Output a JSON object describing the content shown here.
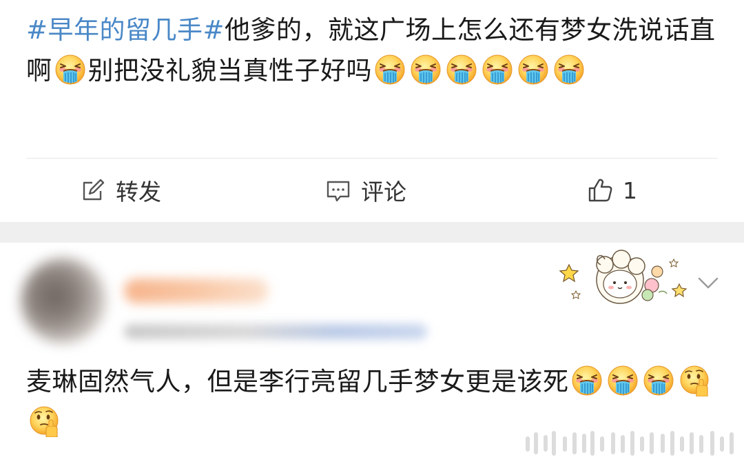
{
  "post": {
    "hashtag": "#早年的留几手#",
    "text_line1": "他爹的，就这广场上怎么还有梦女",
    "text_line2a": "洗说话直啊",
    "text_line2b": "别把没礼貌当真性子好吗"
  },
  "actions": {
    "repost_label": "转发",
    "comment_label": "评论",
    "like_count": "1"
  },
  "comment": {
    "text": "麦琳固然气人，但是李行亮留几手梦女更是该死"
  },
  "icons": {
    "emoji_puke": "puke-rainbow-emoji",
    "emoji_think": "thinking-emoji",
    "repost": "edit-square-icon",
    "comment": "comment-bubble-icon",
    "like": "thumbs-up-icon",
    "more": "chevron-down-icon",
    "sticker": "sheep-sticker-decoration"
  },
  "colors": {
    "hashtag": "#4a88c7",
    "text": "#1a1a1a",
    "action": "#333333",
    "separator_band": "#efefef"
  }
}
